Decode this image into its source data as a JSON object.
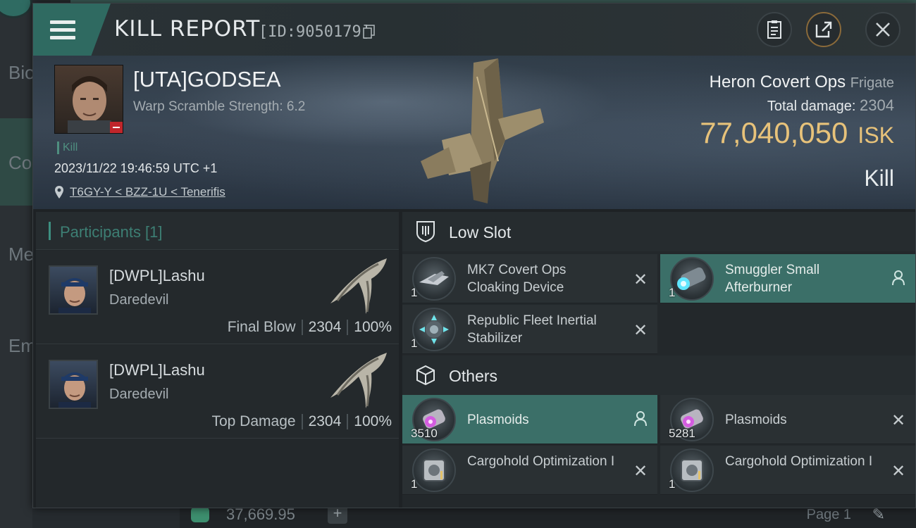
{
  "background": {
    "sidebar_items": [
      "Bio",
      "Co",
      "Me",
      "Em"
    ],
    "bottom_amount": "37,669.95",
    "bottom_page": "Page 1"
  },
  "window": {
    "title": "KILL REPORT",
    "report_id": "[ID:9050179]"
  },
  "victim": {
    "name": "[UTA]GODSEA",
    "warp_scramble": "Warp Scramble Strength: 6.2",
    "tag": "Kill",
    "timestamp": "2023/11/22 19:46:59 UTC +1",
    "location": "T6GY-Y < BZZ-1U < Tenerifis",
    "ship_name": "Heron Covert Ops",
    "ship_class": "Frigate",
    "total_damage_label": "Total damage:",
    "total_damage": "2304",
    "isk_value": "77,040,050",
    "isk_unit": "ISK",
    "result": "Kill"
  },
  "participants": {
    "header": "Participants [1]",
    "rows": [
      {
        "name": "[DWPL]Lashu",
        "ship": "Daredevil",
        "label": "Final Blow",
        "damage": "2304",
        "percent": "100%"
      },
      {
        "name": "[DWPL]Lashu",
        "ship": "Daredevil",
        "label": "Top Damage",
        "damage": "2304",
        "percent": "100%"
      }
    ]
  },
  "low_slot": {
    "header": "Low Slot",
    "items": [
      {
        "name": "MK7 Covert Ops Cloaking Device",
        "qty": "1",
        "status": "destroyed"
      },
      {
        "name": "Smuggler Small Afterburner",
        "qty": "1",
        "status": "dropped"
      },
      {
        "name": "Republic Fleet Inertial Stabilizer",
        "qty": "1",
        "status": "destroyed"
      }
    ]
  },
  "others": {
    "header": "Others",
    "items": [
      {
        "name": "Plasmoids",
        "qty": "3510",
        "status": "dropped"
      },
      {
        "name": "Plasmoids",
        "qty": "5281",
        "status": "destroyed"
      },
      {
        "name": "Cargohold Optimization I",
        "qty": "1",
        "status": "destroyed"
      },
      {
        "name": "Cargohold Optimization I",
        "qty": "1",
        "status": "destroyed"
      }
    ]
  },
  "colors": {
    "accent_teal": "#3b6f68",
    "isk_gold": "#e7c27a",
    "flag_red": "#c0262b"
  }
}
